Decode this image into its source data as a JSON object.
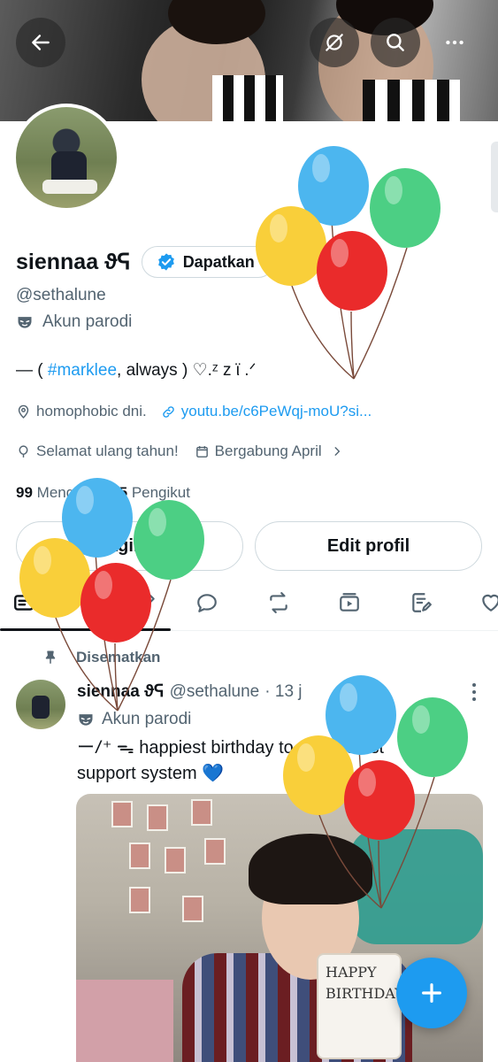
{
  "header": {
    "back_icon": "arrow-left-icon",
    "grok_icon": "grok-icon",
    "search_icon": "search-icon",
    "more_icon": "more-horizontal-icon"
  },
  "profile": {
    "name": "siennaa ϑᕋ",
    "badge_label": "Dapatkan",
    "handle": "@sethalune",
    "parody_label": "Akun parodi",
    "bio_prefix": "— ( ",
    "bio_hashtag": "#marklee",
    "bio_suffix": ", always ) ♡.ᶻ z ϊ .ᐟ",
    "location": "homophobic dni.",
    "website": "youtu.be/c6PeWqj-moU?si...",
    "birthday": "Selamat ulang tahun!",
    "joined": "Bergabung April",
    "following_count": "99",
    "following_label": "Mengikuti",
    "followers_count": "95",
    "followers_label": "Pengikut",
    "share_button": "Bagikan",
    "edit_button": "Edit profil"
  },
  "tabs": [
    "posts",
    "replies",
    "highlights",
    "articles",
    "media",
    "lists",
    "likes"
  ],
  "pinned_post": {
    "pinned_label": "Disematkan",
    "author_name": "siennaa ϑᕋ",
    "author_handle": "@sethalune",
    "time": "· 13 j",
    "parody_label": "Akun parodi",
    "text_line1": "ーⳆ⁺ ᯓ happiest birthday to my bestest",
    "text_line2": "support system 💙",
    "cake_line1": "HAPPY",
    "cake_line2": "BIRTHDAY"
  },
  "colors": {
    "accent": "#1d9bf0",
    "text_primary": "#0f1419",
    "text_secondary": "#536471",
    "border": "#cfd9de",
    "balloon_blue": "#4cb6ef",
    "balloon_green": "#4ccf84",
    "balloon_yellow": "#f9cf3a",
    "balloon_red": "#ea2b2b"
  },
  "fab_icon": "plus-icon"
}
